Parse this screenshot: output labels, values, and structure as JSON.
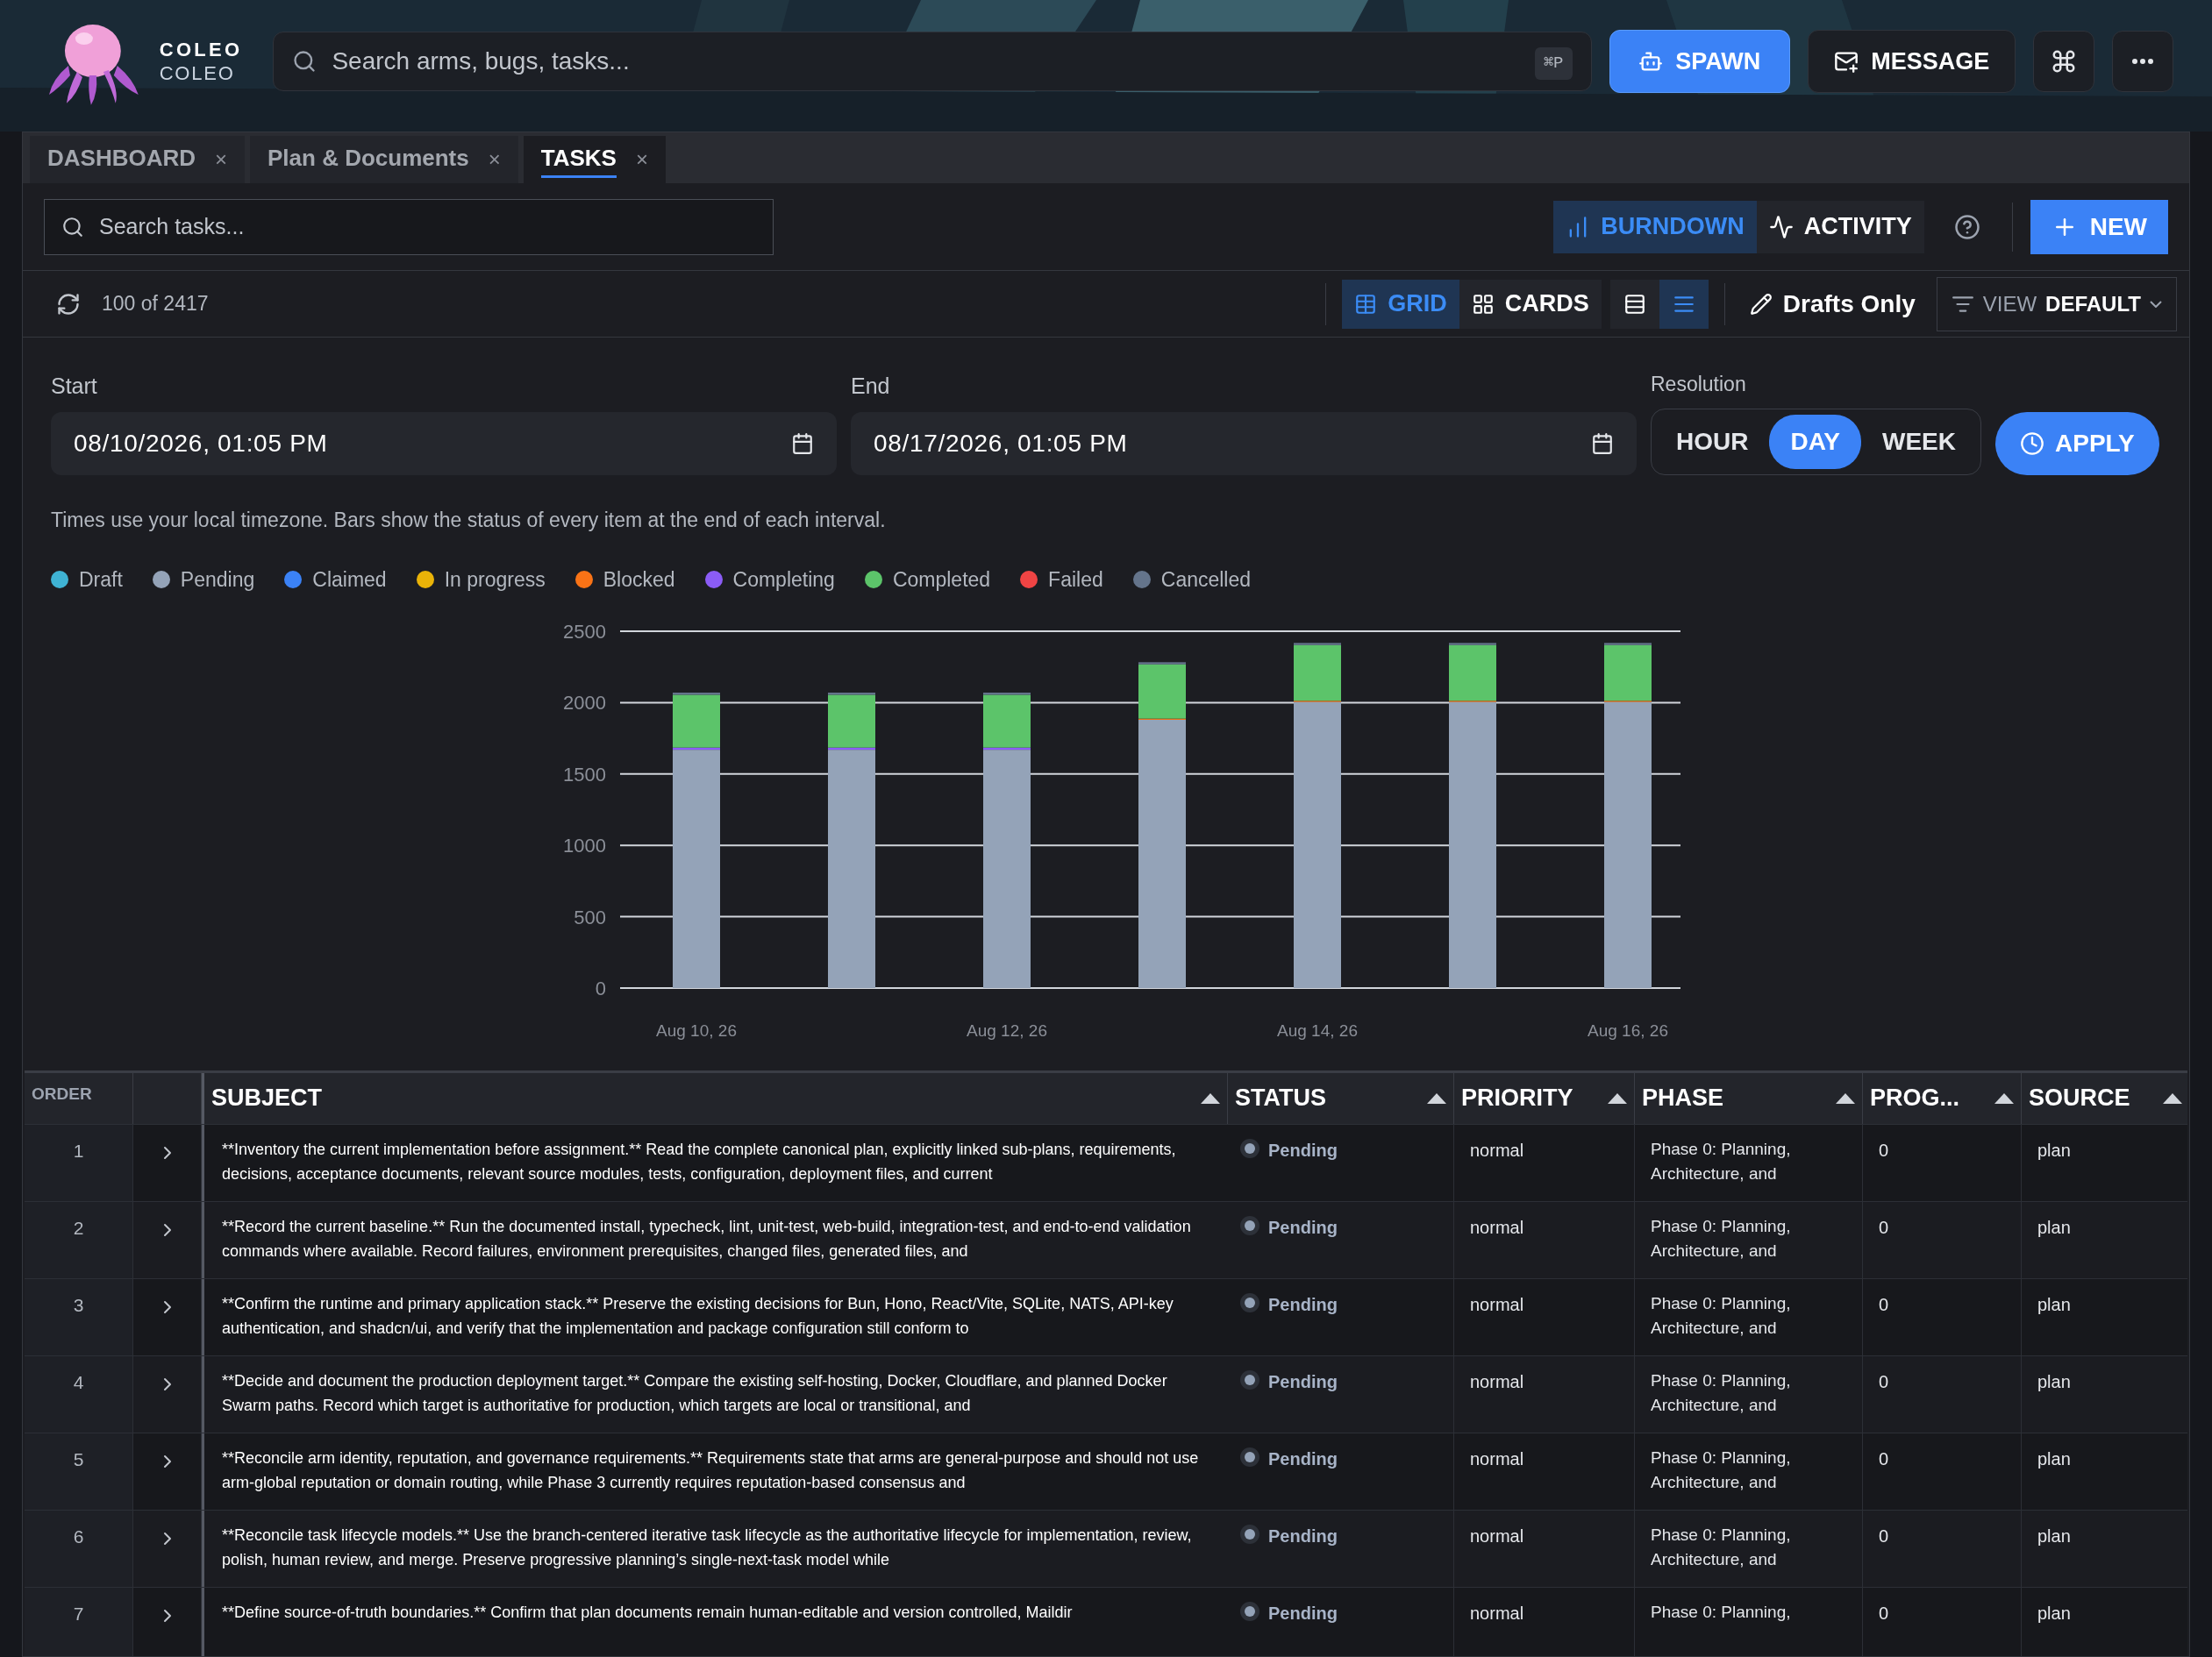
{
  "app": {
    "name": "COLEO",
    "subtitle": "COLEO"
  },
  "search": {
    "placeholder": "Search arms, bugs, tasks...",
    "shortcut": "⌘P"
  },
  "header_actions": [
    {
      "kind": "spawn",
      "label": "SPAWN"
    },
    {
      "kind": "message",
      "label": "MESSAGE"
    }
  ],
  "tabs": [
    {
      "label": "DASHBOARD",
      "selected": false,
      "close": "×"
    },
    {
      "label": "Plan & Documents",
      "selected": false,
      "close": "×"
    },
    {
      "label": "TASKS",
      "selected": true,
      "close": "×"
    }
  ],
  "task_search": {
    "placeholder": "Search tasks..."
  },
  "modes": [
    {
      "kind": "burndown",
      "label": "BURNDOWN",
      "selected": true
    },
    {
      "kind": "activity",
      "label": "ACTIVITY",
      "selected": false
    }
  ],
  "new_button": "NEW",
  "count": "100 of 2417",
  "layouts": [
    {
      "kind": "grid",
      "label": "GRID",
      "selected": true
    },
    {
      "kind": "cards",
      "label": "CARDS",
      "selected": false
    }
  ],
  "density": [
    {
      "kind": "rows",
      "selected": false
    },
    {
      "kind": "list",
      "selected": true
    }
  ],
  "drafts_only": "Drafts Only",
  "view": {
    "label": "VIEW",
    "value": "DEFAULT"
  },
  "range": {
    "start_label": "Start",
    "start": "08/10/2026, 01:05 PM",
    "end_label": "End",
    "end": "08/17/2026, 01:05 PM"
  },
  "resolution": {
    "label": "Resolution",
    "options": [
      {
        "label": "HOUR",
        "selected": false
      },
      {
        "label": "DAY",
        "selected": true
      },
      {
        "label": "WEEK",
        "selected": false
      }
    ]
  },
  "apply": "APPLY",
  "note": "Times use your local timezone. Bars show the status of every item at the end of each interval.",
  "chart_data": {
    "type": "bar",
    "stacked": true,
    "grid": true,
    "categories": [
      "Aug 10, 26",
      null,
      "Aug 12, 26",
      null,
      "Aug 14, 26",
      null,
      "Aug 16, 26"
    ],
    "ylim": [
      0,
      2500
    ],
    "yticks": [
      0,
      500,
      1000,
      1500,
      2000,
      2500
    ],
    "series": [
      {
        "name": "Draft",
        "color": "#3fb3d4",
        "values": [
          0,
          0,
          0,
          0,
          0,
          0,
          0
        ]
      },
      {
        "name": "Pending",
        "color": "#94a3b8",
        "values": [
          1670,
          1670,
          1670,
          1880,
          2005,
          2005,
          2005
        ]
      },
      {
        "name": "Claimed",
        "color": "#3b82f6",
        "values": [
          0,
          0,
          0,
          0,
          0,
          0,
          0
        ]
      },
      {
        "name": "In progress",
        "color": "#eab308",
        "values": [
          0,
          0,
          0,
          0,
          0,
          0,
          0
        ]
      },
      {
        "name": "Blocked",
        "color": "#f97316",
        "values": [
          0,
          0,
          0,
          8,
          8,
          8,
          8
        ]
      },
      {
        "name": "Completing",
        "color": "#8b5cf6",
        "values": [
          15,
          15,
          15,
          0,
          0,
          0,
          0
        ]
      },
      {
        "name": "Completed",
        "color": "#5cc46a",
        "values": [
          370,
          370,
          370,
          380,
          390,
          390,
          390
        ]
      },
      {
        "name": "Failed",
        "color": "#ef4444",
        "values": [
          0,
          0,
          0,
          0,
          0,
          0,
          0
        ]
      },
      {
        "name": "Cancelled",
        "color": "#64748b",
        "values": [
          15,
          15,
          15,
          15,
          15,
          15,
          15
        ]
      }
    ]
  },
  "table": {
    "columns": [
      {
        "label": "ORDER",
        "sortable": false
      },
      {
        "label": "SUBJECT",
        "sortable": true
      },
      {
        "label": "STATUS",
        "sortable": true
      },
      {
        "label": "PRIORITY",
        "sortable": true
      },
      {
        "label": "PHASE",
        "sortable": true
      },
      {
        "label": "PROG...",
        "sortable": true
      },
      {
        "label": "SOURCE",
        "sortable": true
      }
    ],
    "rows": [
      {
        "order": "1",
        "subject": "**Inventory the current implementation before assignment.** Read the complete canonical plan, explicitly linked sub-plans, requirements, decisions, acceptance documents, relevant source modules, tests, configuration, deployment files, and current",
        "status": "Pending",
        "priority": "normal",
        "phase": "Phase 0: Planning, Architecture, and",
        "progress": "0",
        "source": "plan"
      },
      {
        "order": "2",
        "subject": "**Record the current baseline.** Run the documented install, typecheck, lint, unit-test, web-build, integration-test, and end-to-end validation commands where available. Record failures, environment prerequisites, changed files, generated files, and",
        "status": "Pending",
        "priority": "normal",
        "phase": "Phase 0: Planning, Architecture, and",
        "progress": "0",
        "source": "plan"
      },
      {
        "order": "3",
        "subject": "**Confirm the runtime and primary application stack.** Preserve the existing decisions for Bun, Hono, React/Vite, SQLite, NATS, API-key authentication, and shadcn/ui, and verify that the implementation and package configuration still conform to",
        "status": "Pending",
        "priority": "normal",
        "phase": "Phase 0: Planning, Architecture, and",
        "progress": "0",
        "source": "plan"
      },
      {
        "order": "4",
        "subject": "**Decide and document the production deployment target.** Compare the existing self-hosting, Docker, Cloudflare, and planned Docker Swarm paths. Record which target is authoritative for production, which targets are local or transitional, and",
        "status": "Pending",
        "priority": "normal",
        "phase": "Phase 0: Planning, Architecture, and",
        "progress": "0",
        "source": "plan"
      },
      {
        "order": "5",
        "subject": "**Reconcile arm identity, reputation, and governance requirements.** Requirements state that arms are general-purpose and should not use arm-global reputation or domain routing, while Phase 3 currently requires reputation-based consensus and",
        "status": "Pending",
        "priority": "normal",
        "phase": "Phase 0: Planning, Architecture, and",
        "progress": "0",
        "source": "plan"
      },
      {
        "order": "6",
        "subject": "**Reconcile task lifecycle models.** Use the branch-centered iterative task lifecycle as the authoritative lifecycle for implementation, review, polish, human review, and merge. Preserve progressive planning’s single-next-task model while",
        "status": "Pending",
        "priority": "normal",
        "phase": "Phase 0: Planning, Architecture, and",
        "progress": "0",
        "source": "plan"
      },
      {
        "order": "7",
        "subject": "**Define source-of-truth boundaries.** Confirm that plan documents remain human-editable and version controlled, Maildir",
        "status": "Pending",
        "priority": "normal",
        "phase": "Phase 0: Planning,",
        "progress": "0",
        "source": "plan"
      }
    ]
  }
}
